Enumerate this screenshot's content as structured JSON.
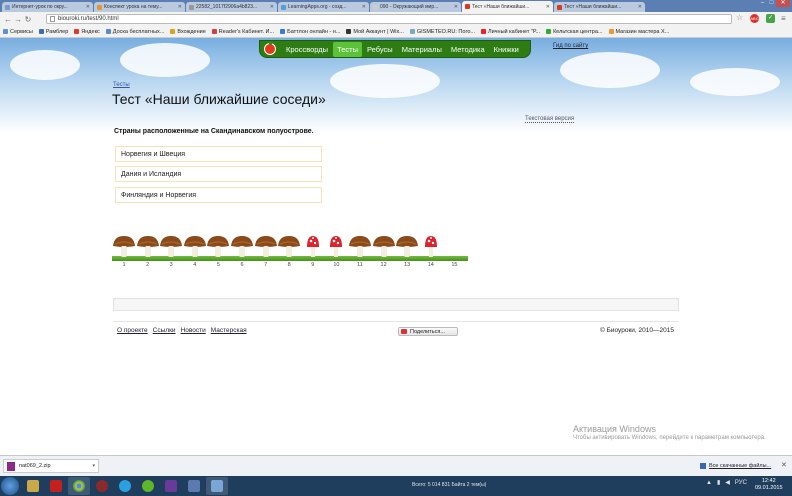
{
  "browser": {
    "tabs": [
      {
        "label": "Интернет-урок по окру...",
        "color": "#7a9ccc",
        "active": false
      },
      {
        "label": "Конспект урока на тему...",
        "color": "#e09a2a",
        "active": false
      },
      {
        "label": "22582_1017f2906a4b823...",
        "color": "#999999",
        "active": false
      },
      {
        "label": "LearningApps.org - созд...",
        "color": "#5a9bd5",
        "active": false
      },
      {
        "label": "090 - Окружающий мир...",
        "color": "#cccccc",
        "active": false
      },
      {
        "label": "Тест «Наши ближайши...",
        "color": "#d63a1f",
        "active": true
      },
      {
        "label": "Тест «Наши ближайши...",
        "color": "#d63a1f",
        "active": false
      }
    ],
    "url": "biouroki.ru/test/90.html",
    "bookmarks": [
      {
        "label": "Сервисы",
        "color": "#5b8fd9"
      },
      {
        "label": "Рамблер",
        "color": "#3a6fb5"
      },
      {
        "label": "Яндекс",
        "color": "#e03a2a"
      },
      {
        "label": "Доска бесплатных...",
        "color": "#5a8ac8"
      },
      {
        "label": "Вхождение",
        "color": "#e0a020"
      },
      {
        "label": "Reader's Кабинет. И...",
        "color": "#c44"
      },
      {
        "label": "Баттлон онлайн - н...",
        "color": "#3a7ad5"
      },
      {
        "label": "Мой Аккаунт | Wix...",
        "color": "#333"
      },
      {
        "label": "GISMETEO.RU: Пого...",
        "color": "#7ab"
      },
      {
        "label": "Личный кабинет \"Р...",
        "color": "#e22"
      },
      {
        "label": "Кельтская центра...",
        "color": "#3a3"
      },
      {
        "label": "Магазин мастера Х...",
        "color": "#e93"
      }
    ],
    "ext_badge": "ABC"
  },
  "site": {
    "nav": [
      "Кроссворды",
      "Тесты",
      "Ребусы",
      "Материалы",
      "Методика",
      "Книжки"
    ],
    "active_nav": 1,
    "help": "Гид по сайту",
    "breadcrumb": "Тесты",
    "title": "Тест «Наши ближайшие соседи»",
    "text_version": "Текстовая версия",
    "question": "Страны расположенные на Скандинавском полуострове.",
    "answers": [
      "Норвегия и Швеция",
      "Дания и Исландия",
      "Финляндия и Норвегия"
    ],
    "progress": {
      "numbers": [
        "1",
        "2",
        "3",
        "4",
        "5",
        "6",
        "7",
        "8",
        "9",
        "10",
        "11",
        "12",
        "13",
        "14",
        "15"
      ],
      "states": [
        "brown",
        "brown",
        "brown",
        "brown",
        "brown",
        "brown",
        "brown",
        "brown",
        "red",
        "red",
        "brown",
        "brown",
        "brown",
        "red",
        "empty"
      ]
    },
    "footer_links": [
      "О проекте",
      "Ссылки",
      "Новости",
      "Мастерская"
    ],
    "share": "Поделиться...",
    "copyright": "© Биоуроки, 2010—2015"
  },
  "windows_activation": {
    "title": "Активация Windows",
    "text": "Чтобы активировать Windows, перейдите к параметрам компьютера."
  },
  "downloads": {
    "file": "nat069_2.zip",
    "all": "Все скачанные файлы..."
  },
  "taskbar": {
    "status": "Всего: 5 014 831 Байта 2 тем(ы)",
    "lang": "РУС",
    "time": "12:42",
    "date": "09.01.2015"
  }
}
